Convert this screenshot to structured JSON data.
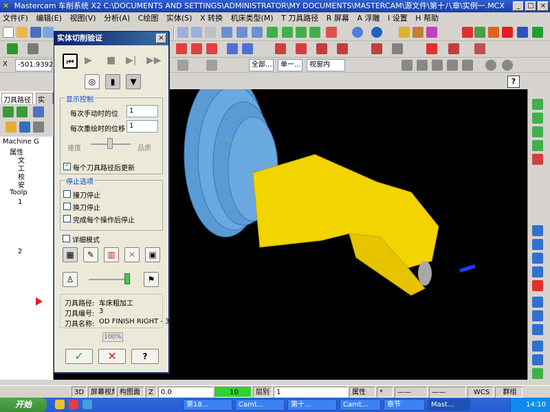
{
  "window": {
    "app_name": "Mastercam",
    "title_text": "车削系统  X2  C:\\DOCUMENTS AND SETTINGS\\ADMINISTRATOR\\MY DOCUMENTS\\MASTERCAM\\源文件\\第十八章\\实例一.MCX"
  },
  "menu": [
    "文件(F)",
    "编辑(E)",
    "视图(V)",
    "分析(A)",
    "C绘图",
    "实体(S)",
    "X 转换",
    "机床类型(M)",
    "T 刀具路径",
    "R 屏幕",
    "A 浮雕",
    "I 设置",
    "H 帮助"
  ],
  "toolbar3": {
    "coord_x": "-501.9392",
    "select_all": "全部...",
    "select_single": "单一...",
    "window_mode": "视窗内"
  },
  "left_panel": {
    "tab_toolpaths": "刀具路径",
    "tab_solids": "实体",
    "tree": [
      "Machine G",
      "属性",
      "文",
      "工",
      "校",
      "安",
      "Toolp",
      "1",
      "2"
    ]
  },
  "dialog": {
    "title": "实体切削验证",
    "display_group": "显示控制",
    "step_label": "每次手动时的位",
    "step_value": "1",
    "redraw_label": "每次重绘时的位移",
    "redraw_value": "1",
    "speed_label": "速度",
    "quality_label": "品质",
    "update_label": "每个刀具路径后更新",
    "stop_group": "停止选项",
    "stop_collision": "撞刀停止",
    "stop_toolchange": "换刀停止",
    "stop_each_op": "完成每个操作后停止",
    "verbose_mode": "详细模式",
    "info_path_label": "刀具路径:",
    "info_path_value": "车床粗加工",
    "info_num_label": "刀具编号:",
    "info_num_value": "3",
    "info_name_label": "刀具名称:",
    "info_name_value": "OD FINISH RIGHT - 35",
    "progress": "100%"
  },
  "statusbar": {
    "mode_3d": "3D",
    "screen_view": "屏幕视角",
    "plane": "构图面",
    "z_label": "Z",
    "z_value": "0.0",
    "color_value": "10",
    "level_label": "层别",
    "level_value": "1",
    "attributes": "属性",
    "wcs": "WCS",
    "group": "群组"
  },
  "taskbar": {
    "start": "开始",
    "tasks": [
      "第18...",
      "Camt...",
      "第十...",
      "Camt...",
      "章节",
      "Mast..."
    ],
    "clock": "14:10"
  },
  "colors": {
    "viewport_bg": "#000000",
    "part_yellow": "#f2d400",
    "stock_blue": "#5b9bd5",
    "title_blue": "#1a3faa"
  }
}
